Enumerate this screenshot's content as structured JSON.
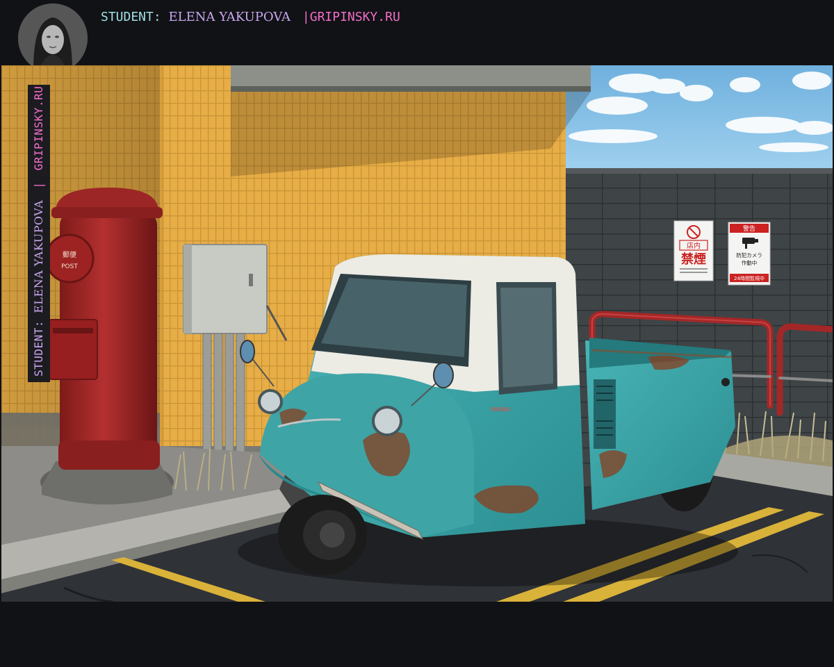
{
  "header": {
    "student_label": "STUDENT:",
    "student_name": "ELENA YAKUPOVA",
    "separator": "|",
    "site": "GRIPINSKY.RU"
  },
  "side_label": {
    "student_label": "STUDENT:",
    "student_name": "ELENA YAKUPOVA",
    "separator": "|",
    "site": "GRIPINSKY.RU"
  },
  "signs": {
    "no_smoking_line1": "店内",
    "no_smoking_line2": "禁煙",
    "camera_title": "警告",
    "camera_line": "防犯カメラ",
    "camera_line2": "作動中",
    "camera_bottom": "24時間監視中"
  },
  "postbox": {
    "label_jp": "郵便",
    "label_en": "POST"
  },
  "colors": {
    "accent_cyan": "#9fe0e6",
    "accent_lavender": "#c9a7f0",
    "accent_pink": "#f06ec8",
    "truck_teal": "#3aa7a9",
    "postbox_red": "#a82626",
    "tile_yellow": "#e8b04a"
  }
}
